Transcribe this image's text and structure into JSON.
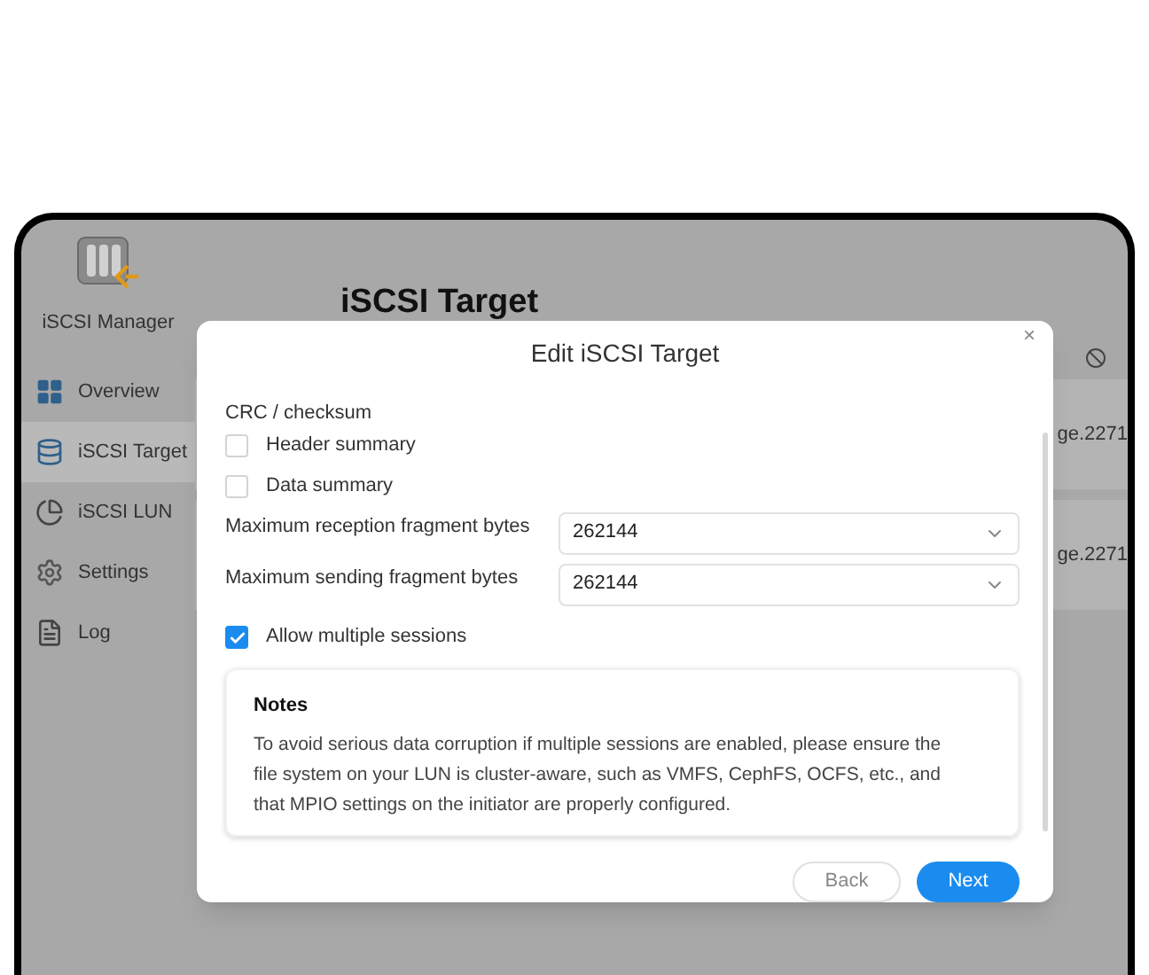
{
  "app": {
    "name": "iSCSI Manager"
  },
  "sidebar": {
    "items": [
      {
        "label": "Overview",
        "selected": false
      },
      {
        "label": "iSCSI Target",
        "selected": true
      },
      {
        "label": "iSCSI LUN",
        "selected": false
      },
      {
        "label": "Settings",
        "selected": false
      },
      {
        "label": "Log",
        "selected": false
      }
    ]
  },
  "page": {
    "title": "iSCSI Target",
    "rows": [
      {
        "text": "ge.2271"
      },
      {
        "text": "ge.2271"
      }
    ]
  },
  "dialog": {
    "title": "Edit iSCSI Target",
    "close": "×",
    "section": "CRC / checksum",
    "checkboxes": [
      {
        "label": "Header summary",
        "checked": false
      },
      {
        "label": "Data summary",
        "checked": false
      }
    ],
    "selects": [
      {
        "label": "Maximum reception fragment bytes",
        "value": "262144"
      },
      {
        "label": "Maximum sending fragment bytes",
        "value": "262144"
      }
    ],
    "multi_session": {
      "label": "Allow multiple sessions",
      "checked": true
    },
    "notes": {
      "title": "Notes",
      "text": "To avoid serious data corruption if multiple sessions are enabled, please ensure the file system on your LUN is cluster-aware, such as VMFS, CephFS, OCFS, etc., and that MPIO settings on the initiator are properly configured."
    },
    "buttons": [
      {
        "label": "Back",
        "kind": "secondary"
      },
      {
        "label": "Next",
        "kind": "primary"
      }
    ]
  }
}
